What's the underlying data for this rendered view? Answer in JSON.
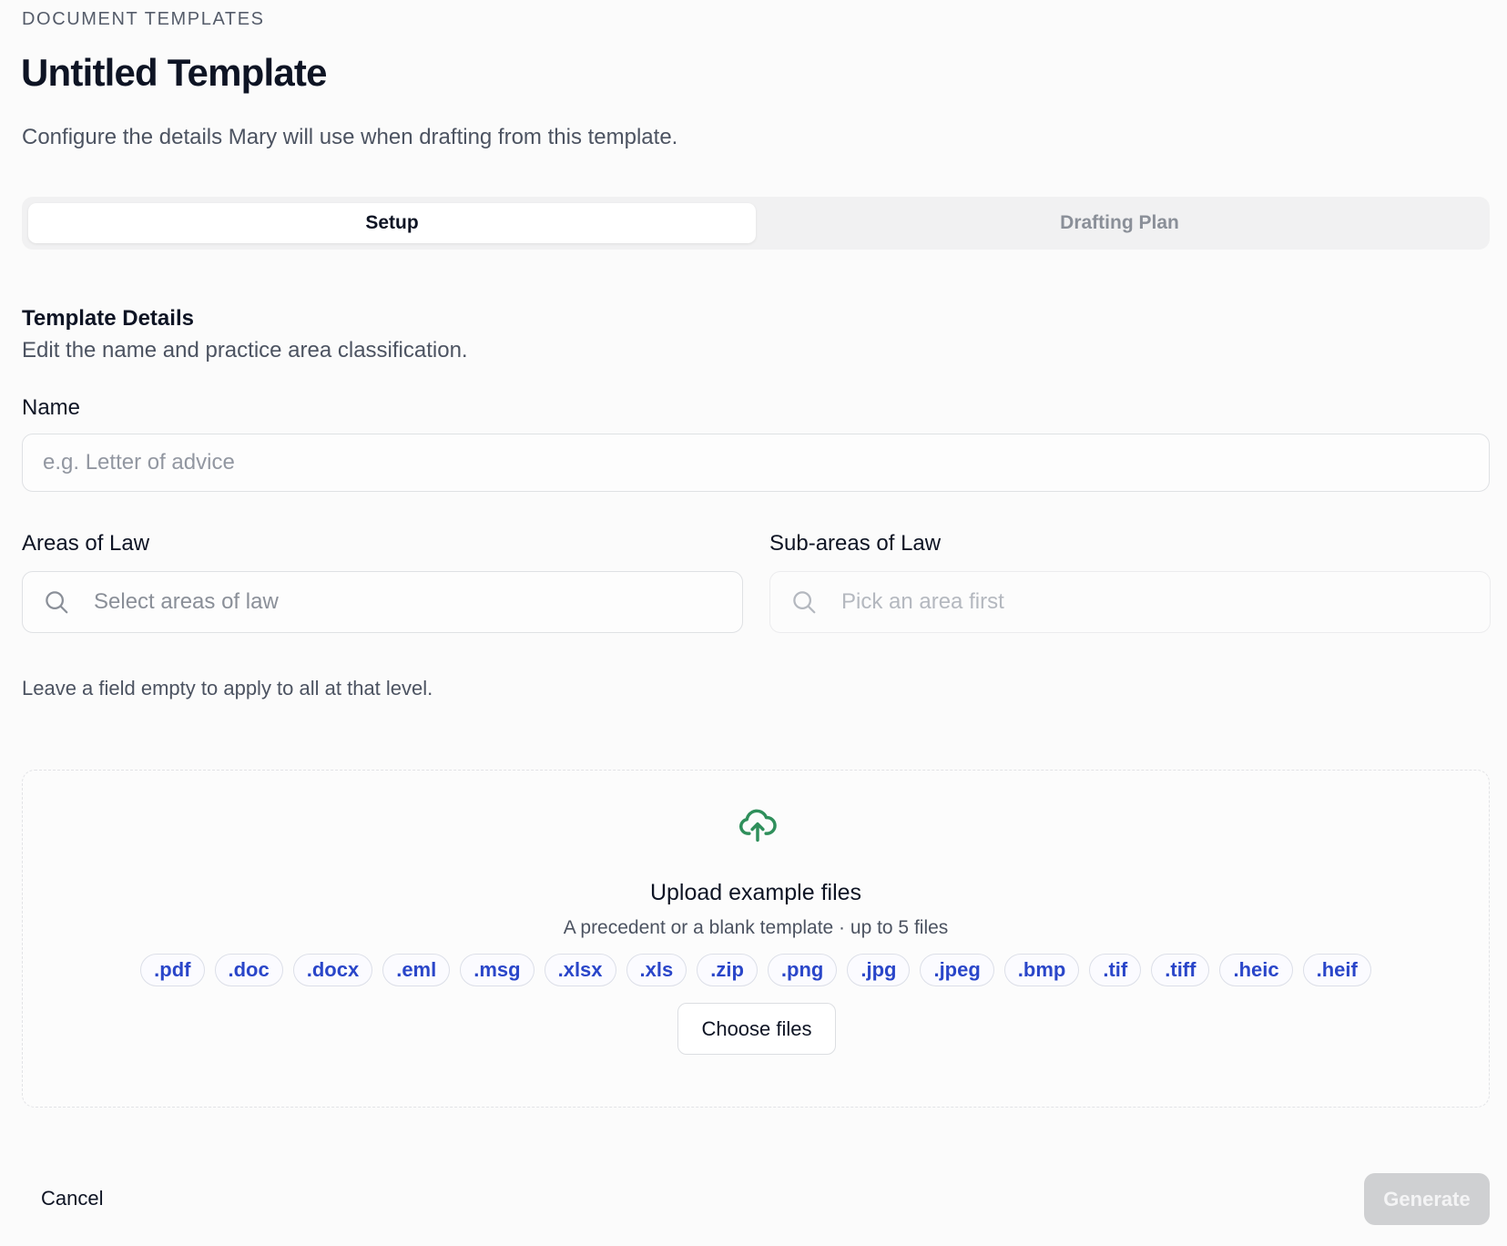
{
  "header": {
    "eyebrow": "DOCUMENT TEMPLATES",
    "title": "Untitled Template",
    "subtitle": "Configure the details Mary will use when drafting from this template."
  },
  "tabs": [
    {
      "label": "Setup",
      "active": true
    },
    {
      "label": "Drafting Plan",
      "active": false
    }
  ],
  "details": {
    "title": "Template Details",
    "description": "Edit the name and practice area classification."
  },
  "name_field": {
    "label": "Name",
    "value": "",
    "placeholder": "e.g. Letter of advice"
  },
  "areas_field": {
    "label": "Areas of Law",
    "placeholder": "Select areas of law",
    "icon": "search-icon"
  },
  "subareas_field": {
    "label": "Sub-areas of Law",
    "placeholder": "Pick an area first",
    "icon": "search-icon",
    "disabled": true
  },
  "hint": "Leave a field empty to apply to all at that level.",
  "upload": {
    "icon": "cloud-upload-icon",
    "title": "Upload example files",
    "subtitle": "A precedent or a blank template · up to 5 files",
    "file_types": [
      ".pdf",
      ".doc",
      ".docx",
      ".eml",
      ".msg",
      ".xlsx",
      ".xls",
      ".zip",
      ".png",
      ".jpg",
      ".jpeg",
      ".bmp",
      ".tif",
      ".tiff",
      ".heic",
      ".heif"
    ],
    "button_label": "Choose files"
  },
  "footer": {
    "cancel_label": "Cancel",
    "generate_label": "Generate",
    "generate_disabled": true
  },
  "colors": {
    "accent_green": "#2f8f5b",
    "chip_text": "#2a46c9",
    "disabled_button": "#cfd0d2"
  }
}
